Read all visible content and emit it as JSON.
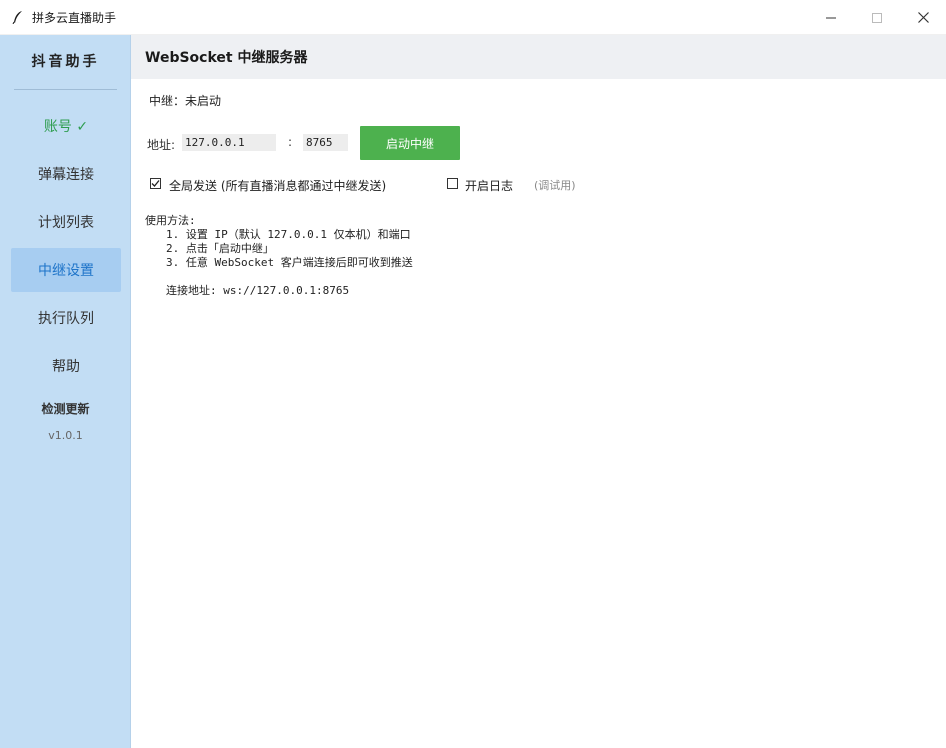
{
  "window": {
    "title": "拼多云直播助手",
    "icon": "feather-icon",
    "controls": [
      "minimize-icon",
      "maximize-icon",
      "close-icon"
    ]
  },
  "sidebar": {
    "brand": "抖音助手",
    "items": [
      {
        "label": "账号 ✓",
        "state": "ok"
      },
      {
        "label": "弹幕连接",
        "state": "normal"
      },
      {
        "label": "计划列表",
        "state": "normal"
      },
      {
        "label": "中继设置",
        "state": "active"
      },
      {
        "label": "执行队列",
        "state": "normal"
      },
      {
        "label": "帮助",
        "state": "normal"
      }
    ],
    "update": "检测更新",
    "version": "v1.0.1"
  },
  "main": {
    "header": "WebSocket 中继服务器",
    "status": "中继：未启动",
    "address_label": "地址:",
    "host": "127.0.0.1",
    "colon": ":",
    "port": "8765",
    "start_button": "启动中继",
    "global_send": {
      "label": "全局发送 (所有直播消息都通过中继发送)",
      "checked": true
    },
    "enable_log": {
      "label": "开启日志",
      "checked": false
    },
    "debug_note": "(调试用)",
    "usage": {
      "title": "使用方法:",
      "steps": [
        "1. 设置 IP（默认 127.0.0.1 仅本机）和端口",
        "2. 点击「启动中继」",
        "3. 任意 WebSocket 客户端连接后即可收到推送"
      ],
      "connect": "连接地址: ws://127.0.0.1:8765"
    }
  },
  "colors": {
    "sidebar_bg": "#c2ddf4",
    "active_bg": "#a7cdf1",
    "active_text": "#1e74c9",
    "ok_text": "#2e9d4f",
    "start_button": "#4db14e",
    "header_bg": "#eef0f3"
  }
}
